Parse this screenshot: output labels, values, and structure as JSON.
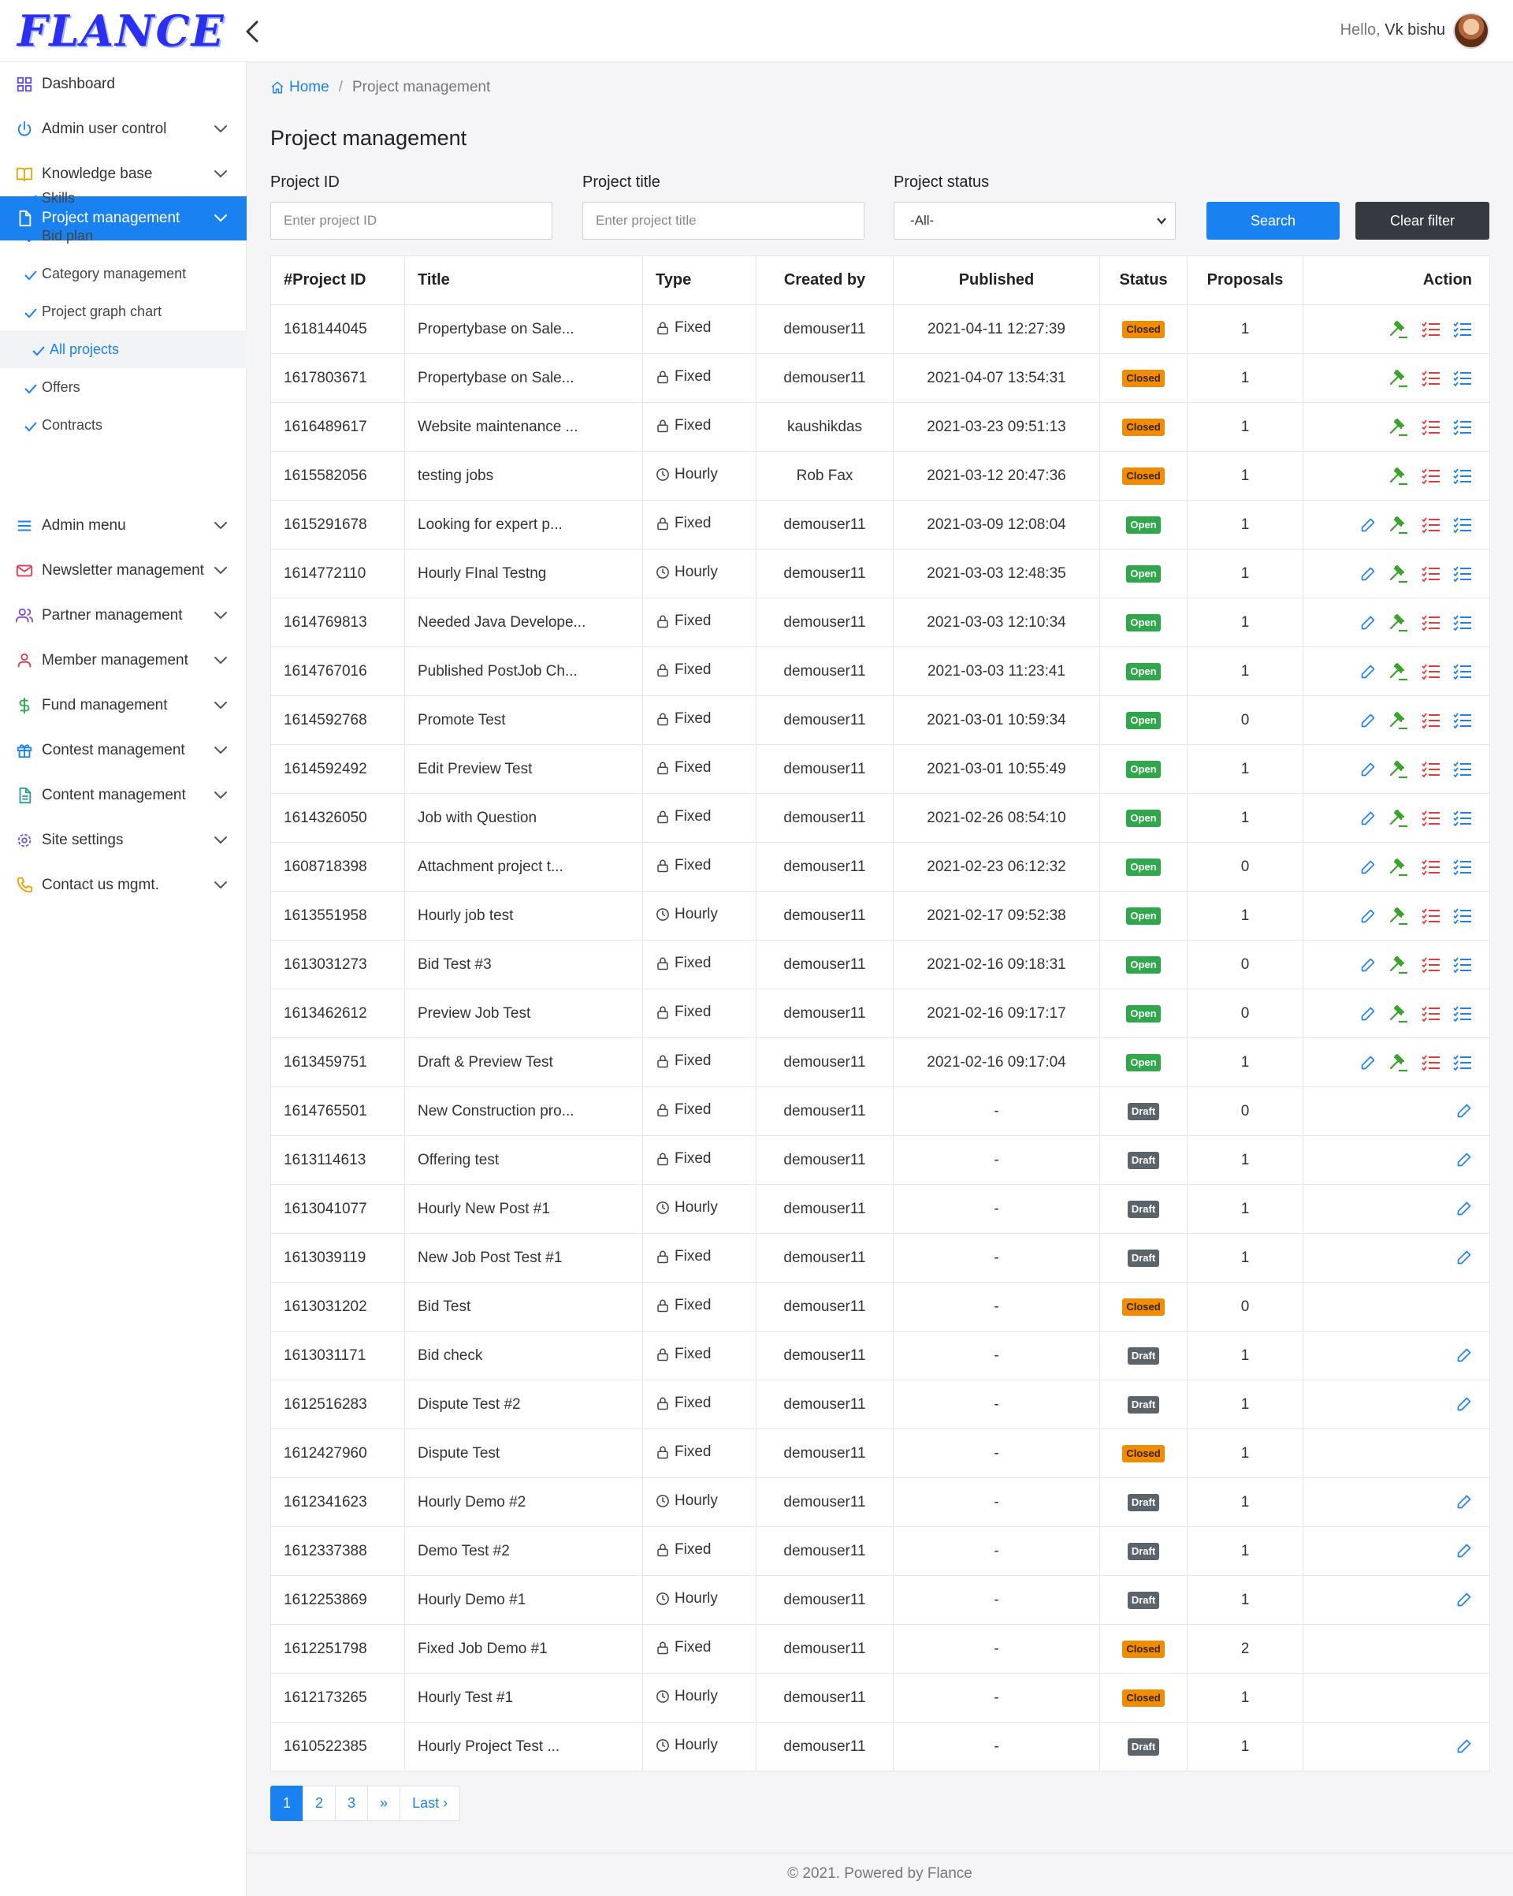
{
  "brand": {
    "logo_text": "FLANCE"
  },
  "header": {
    "greeting": "Hello,",
    "username": "Vk bishu"
  },
  "sidebar": {
    "items": [
      {
        "label": "Dashboard",
        "icon": "dashboard-grid-icon"
      },
      {
        "label": "Admin user control",
        "icon": "power-icon"
      },
      {
        "label": "Knowledge base",
        "icon": "book-icon"
      },
      {
        "label": "Project management",
        "icon": "document-icon",
        "active": true
      },
      {
        "label": "Admin menu",
        "icon": "menu-icon"
      },
      {
        "label": "Newsletter management",
        "icon": "mail-icon"
      },
      {
        "label": "Partner management",
        "icon": "users-icon"
      },
      {
        "label": "Member management",
        "icon": "user-icon"
      },
      {
        "label": "Fund management",
        "icon": "dollar-icon"
      },
      {
        "label": "Contest management",
        "icon": "gift-icon"
      },
      {
        "label": "Content management",
        "icon": "file-text-icon"
      },
      {
        "label": "Site settings",
        "icon": "gear-icon"
      },
      {
        "label": "Contact us mgmt.",
        "icon": "phone-icon"
      }
    ],
    "sub_items": [
      {
        "label": "Skills"
      },
      {
        "label": "Bid plan"
      },
      {
        "label": "Category management"
      },
      {
        "label": "Project graph chart"
      },
      {
        "label": "All projects",
        "active": true
      },
      {
        "label": "Offers"
      },
      {
        "label": "Contracts"
      }
    ]
  },
  "breadcrumb": {
    "home": "Home",
    "current": "Project management"
  },
  "page": {
    "title": "Project management"
  },
  "filters": {
    "project_id": {
      "label": "Project ID",
      "placeholder": "Enter project ID"
    },
    "project_title": {
      "label": "Project title",
      "placeholder": "Enter project title"
    },
    "project_status": {
      "label": "Project status",
      "value": "-All-"
    },
    "search_label": "Search",
    "clear_label": "Clear filter"
  },
  "table": {
    "headers": {
      "id": "#Project ID",
      "title": "Title",
      "type": "Type",
      "created_by": "Created by",
      "published": "Published",
      "status": "Status",
      "proposals": "Proposals",
      "action": "Action"
    },
    "rows": [
      {
        "id": "1618144045",
        "title": "Propertybase on Sale...",
        "type": "Fixed",
        "created_by": "demouser11",
        "published": "2021-04-11 12:27:39",
        "status": "Closed",
        "proposals": "1",
        "actions": "award"
      },
      {
        "id": "1617803671",
        "title": "Propertybase on Sale...",
        "type": "Fixed",
        "created_by": "demouser11",
        "published": "2021-04-07 13:54:31",
        "status": "Closed",
        "proposals": "1",
        "actions": "award"
      },
      {
        "id": "1616489617",
        "title": "Website maintenance ...",
        "type": "Fixed",
        "created_by": "kaushikdas",
        "published": "2021-03-23 09:51:13",
        "status": "Closed",
        "proposals": "1",
        "actions": "award"
      },
      {
        "id": "1615582056",
        "title": "testing jobs",
        "type": "Hourly",
        "created_by": "Rob Fax",
        "published": "2021-03-12 20:47:36",
        "status": "Closed",
        "proposals": "1",
        "actions": "award"
      },
      {
        "id": "1615291678",
        "title": "Looking for expert p...",
        "type": "Fixed",
        "created_by": "demouser11",
        "published": "2021-03-09 12:08:04",
        "status": "Open",
        "proposals": "1",
        "actions": "full"
      },
      {
        "id": "1614772110",
        "title": "Hourly FInal Testng",
        "type": "Hourly",
        "created_by": "demouser11",
        "published": "2021-03-03 12:48:35",
        "status": "Open",
        "proposals": "1",
        "actions": "full"
      },
      {
        "id": "1614769813",
        "title": "Needed Java Develope...",
        "type": "Fixed",
        "created_by": "demouser11",
        "published": "2021-03-03 12:10:34",
        "status": "Open",
        "proposals": "1",
        "actions": "full"
      },
      {
        "id": "1614767016",
        "title": "Published PostJob Ch...",
        "type": "Fixed",
        "created_by": "demouser11",
        "published": "2021-03-03 11:23:41",
        "status": "Open",
        "proposals": "1",
        "actions": "full"
      },
      {
        "id": "1614592768",
        "title": "Promote Test",
        "type": "Fixed",
        "created_by": "demouser11",
        "published": "2021-03-01 10:59:34",
        "status": "Open",
        "proposals": "0",
        "actions": "full"
      },
      {
        "id": "1614592492",
        "title": "Edit Preview Test",
        "type": "Fixed",
        "created_by": "demouser11",
        "published": "2021-03-01 10:55:49",
        "status": "Open",
        "proposals": "1",
        "actions": "full"
      },
      {
        "id": "1614326050",
        "title": "Job with Question",
        "type": "Fixed",
        "created_by": "demouser11",
        "published": "2021-02-26 08:54:10",
        "status": "Open",
        "proposals": "1",
        "actions": "full"
      },
      {
        "id": "1608718398",
        "title": "Attachment project t...",
        "type": "Fixed",
        "created_by": "demouser11",
        "published": "2021-02-23 06:12:32",
        "status": "Open",
        "proposals": "0",
        "actions": "full"
      },
      {
        "id": "1613551958",
        "title": "Hourly job test",
        "type": "Hourly",
        "created_by": "demouser11",
        "published": "2021-02-17 09:52:38",
        "status": "Open",
        "proposals": "1",
        "actions": "full"
      },
      {
        "id": "1613031273",
        "title": "Bid Test #3",
        "type": "Fixed",
        "created_by": "demouser11",
        "published": "2021-02-16 09:18:31",
        "status": "Open",
        "proposals": "0",
        "actions": "full"
      },
      {
        "id": "1613462612",
        "title": "Preview Job Test",
        "type": "Fixed",
        "created_by": "demouser11",
        "published": "2021-02-16 09:17:17",
        "status": "Open",
        "proposals": "0",
        "actions": "full"
      },
      {
        "id": "1613459751",
        "title": "Draft & Preview Test",
        "type": "Fixed",
        "created_by": "demouser11",
        "published": "2021-02-16 09:17:04",
        "status": "Open",
        "proposals": "1",
        "actions": "full"
      },
      {
        "id": "1614765501",
        "title": "New Construction pro...",
        "type": "Fixed",
        "created_by": "demouser11",
        "published": "-",
        "status": "Draft",
        "proposals": "0",
        "actions": "edit"
      },
      {
        "id": "1613114613",
        "title": "Offering test",
        "type": "Fixed",
        "created_by": "demouser11",
        "published": "-",
        "status": "Draft",
        "proposals": "1",
        "actions": "edit"
      },
      {
        "id": "1613041077",
        "title": "Hourly New Post #1",
        "type": "Hourly",
        "created_by": "demouser11",
        "published": "-",
        "status": "Draft",
        "proposals": "1",
        "actions": "edit"
      },
      {
        "id": "1613039119",
        "title": "New Job Post Test #1",
        "type": "Fixed",
        "created_by": "demouser11",
        "published": "-",
        "status": "Draft",
        "proposals": "1",
        "actions": "edit"
      },
      {
        "id": "1613031202",
        "title": "Bid Test",
        "type": "Fixed",
        "created_by": "demouser11",
        "published": "-",
        "status": "Closed",
        "proposals": "0",
        "actions": "none"
      },
      {
        "id": "1613031171",
        "title": "Bid check",
        "type": "Fixed",
        "created_by": "demouser11",
        "published": "-",
        "status": "Draft",
        "proposals": "1",
        "actions": "edit"
      },
      {
        "id": "1612516283",
        "title": "Dispute Test #2",
        "type": "Fixed",
        "created_by": "demouser11",
        "published": "-",
        "status": "Draft",
        "proposals": "1",
        "actions": "edit"
      },
      {
        "id": "1612427960",
        "title": "Dispute Test",
        "type": "Fixed",
        "created_by": "demouser11",
        "published": "-",
        "status": "Closed",
        "proposals": "1",
        "actions": "none"
      },
      {
        "id": "1612341623",
        "title": "Hourly Demo #2",
        "type": "Hourly",
        "created_by": "demouser11",
        "published": "-",
        "status": "Draft",
        "proposals": "1",
        "actions": "edit"
      },
      {
        "id": "1612337388",
        "title": "Demo Test #2",
        "type": "Fixed",
        "created_by": "demouser11",
        "published": "-",
        "status": "Draft",
        "proposals": "1",
        "actions": "edit"
      },
      {
        "id": "1612253869",
        "title": "Hourly Demo #1",
        "type": "Hourly",
        "created_by": "demouser11",
        "published": "-",
        "status": "Draft",
        "proposals": "1",
        "actions": "edit"
      },
      {
        "id": "1612251798",
        "title": "Fixed Job Demo #1",
        "type": "Fixed",
        "created_by": "demouser11",
        "published": "-",
        "status": "Closed",
        "proposals": "2",
        "actions": "none"
      },
      {
        "id": "1612173265",
        "title": "Hourly Test #1",
        "type": "Hourly",
        "created_by": "demouser11",
        "published": "-",
        "status": "Closed",
        "proposals": "1",
        "actions": "none"
      },
      {
        "id": "1610522385",
        "title": "Hourly Project Test ...",
        "type": "Hourly",
        "created_by": "demouser11",
        "published": "-",
        "status": "Draft",
        "proposals": "1",
        "actions": "edit"
      }
    ]
  },
  "pagination": {
    "pages": [
      "1",
      "2",
      "3"
    ],
    "next": "»",
    "last": "Last ›",
    "current": "1"
  },
  "footer": {
    "text": "© 2021. Powered by Flance"
  },
  "colors": {
    "primary": "#1a82f0",
    "dark": "#343a40",
    "closed": "#f08c00",
    "open": "#2ea84a",
    "draft": "#5b636b",
    "award_green": "#3aa32b",
    "list_red": "#e53935"
  }
}
